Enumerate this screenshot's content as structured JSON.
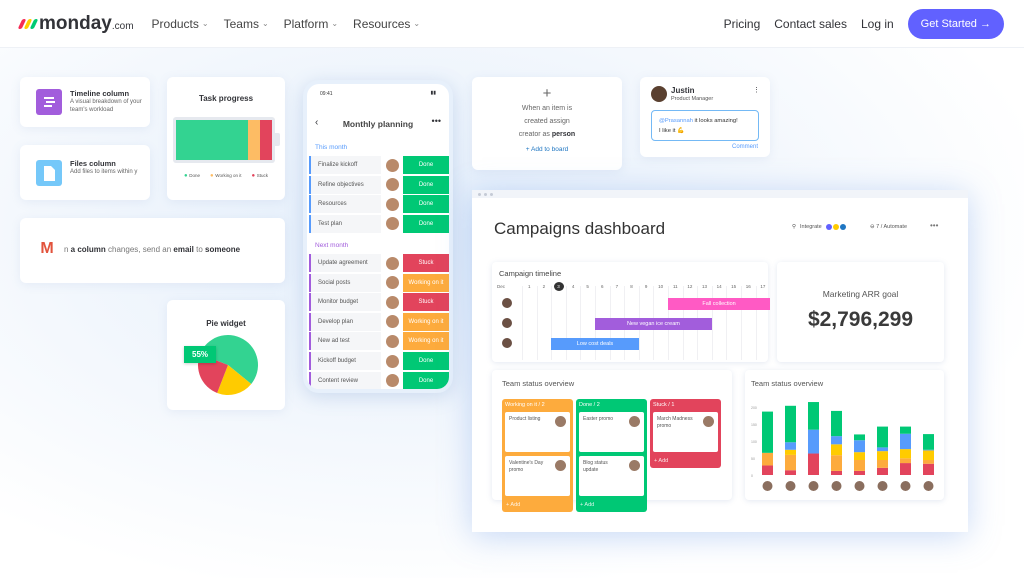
{
  "nav": {
    "logo": "monday",
    "logo_suffix": ".com",
    "menu": [
      "Products",
      "Teams",
      "Platform",
      "Resources"
    ],
    "pricing": "Pricing",
    "contact": "Contact sales",
    "login": "Log in",
    "cta": "Get Started",
    "cta_icon": "arrow-right-icon"
  },
  "timeline_card": {
    "title": "Timeline column",
    "desc": "A visual breakdown of your team's workload"
  },
  "files_card": {
    "title": "Files column",
    "desc": "Add files to items within y"
  },
  "task_progress": {
    "title": "Task progress",
    "segments": [
      {
        "label": "Done",
        "value": 75,
        "color": "#33d391"
      },
      {
        "label": "Working on it",
        "value": 12,
        "color": "#fdbc64"
      },
      {
        "label": "Stuck",
        "value": 13,
        "color": "#e2445c"
      }
    ]
  },
  "email_card": {
    "pre": "n ",
    "b1": "a column",
    "mid": " changes, send an ",
    "b2": "email",
    "mid2": " to ",
    "b3": "someone"
  },
  "pie": {
    "title": "Pie widget",
    "label": "55%",
    "slices": [
      {
        "value": 55,
        "color": "#33d391"
      },
      {
        "value": 20,
        "color": "#ffcb00"
      },
      {
        "value": 25,
        "color": "#e2445c"
      }
    ]
  },
  "phone": {
    "time": "09:41",
    "title": "Monthly planning",
    "this_month": "This month",
    "next_month": "Next month",
    "this_items": [
      {
        "name": "Finalize kickoff",
        "status": "Done"
      },
      {
        "name": "Refine objectives",
        "status": "Done"
      },
      {
        "name": "Resources",
        "status": "Done"
      },
      {
        "name": "Test plan",
        "status": "Done"
      }
    ],
    "next_items": [
      {
        "name": "Update agreement",
        "status": "Stuck"
      },
      {
        "name": "Social posts",
        "status": "Working on it"
      },
      {
        "name": "Monitor budget",
        "status": "Stuck"
      },
      {
        "name": "Develop plan",
        "status": "Working on it"
      },
      {
        "name": "New ad test",
        "status": "Working on it"
      },
      {
        "name": "Kickoff budget",
        "status": "Done"
      },
      {
        "name": "Content review",
        "status": "Done"
      }
    ]
  },
  "status_colors": {
    "Done": "#00c875",
    "Stuck": "#e2445c",
    "Working on it": "#fdab3d"
  },
  "automation": {
    "line1": "When an item is",
    "line2": "created assign",
    "line3": "creator as ",
    "bold": "person",
    "link": "+ Add to board"
  },
  "comment": {
    "name": "Justin",
    "role": "Product Manager",
    "mention": "@Prasannah",
    "text": " it looks amazing!",
    "text2": "I like it 💪",
    "action": "Comment"
  },
  "dashboard": {
    "title": "Campaigns dashboard",
    "integrate": "Integrate",
    "automate": "7 / Automate",
    "timeline": {
      "title": "Campaign timeline",
      "days": [
        "Dec",
        "1",
        "2",
        "3",
        "4",
        "5",
        "6",
        "7",
        "8",
        "9",
        "10",
        "11",
        "12",
        "13",
        "14",
        "15",
        "16",
        "17"
      ],
      "today": "3",
      "bars": [
        {
          "label": "Fall collection",
          "start": 11,
          "end": 17,
          "color": "#ff5ac4"
        },
        {
          "label": "New vegan ice cream",
          "start": 6,
          "end": 13,
          "color": "#a25ddc"
        },
        {
          "label": "Low cost deals",
          "start": 3,
          "end": 8,
          "color": "#579bfc"
        }
      ]
    },
    "arr": {
      "title": "Marketing ARR goal",
      "value": "$2,796,299"
    },
    "kanban": {
      "title": "Team status overview",
      "columns": [
        {
          "header": "Working on it / 2",
          "color": "#fdab3d",
          "cards": [
            "Product listing",
            "Valentine's Day promo"
          ],
          "add": "+ Add"
        },
        {
          "header": "Done / 2",
          "color": "#00c875",
          "cards": [
            "Easter promo",
            "Blog status update"
          ],
          "add": "+ Add"
        },
        {
          "header": "Stuck / 1",
          "color": "#e2445c",
          "cards": [
            "March Madness promo"
          ],
          "add": "+ Add"
        }
      ]
    }
  },
  "chart_data": {
    "type": "bar",
    "stacked": true,
    "title": "Team status overview",
    "yticks": [
      "0",
      "50",
      "100",
      "150",
      "200"
    ],
    "ylim": [
      0,
      220
    ],
    "colors": [
      "#e2445c",
      "#fdab3d",
      "#ffcb00",
      "#579bfc",
      "#00c875"
    ],
    "series": [
      {
        "values": [
          28,
          14,
          63,
          12,
          12,
          21,
          35,
          33
        ]
      },
      {
        "values": [
          37,
          45,
          0,
          46,
          32,
          23,
          14,
          11
        ]
      },
      {
        "values": [
          0,
          15,
          0,
          32,
          23,
          26,
          27,
          28
        ]
      },
      {
        "values": [
          0,
          22,
          70,
          24,
          35,
          11,
          45,
          2
        ]
      },
      {
        "values": [
          121,
          107,
          81,
          74,
          17,
          61,
          21,
          46
        ]
      }
    ]
  }
}
